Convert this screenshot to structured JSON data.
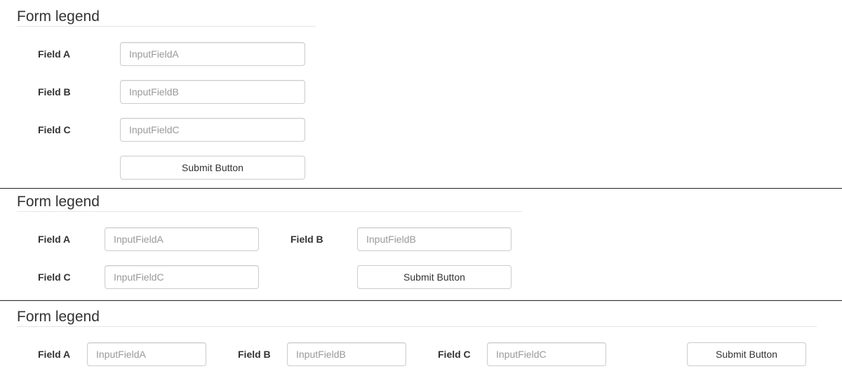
{
  "forms": [
    {
      "legend": "Form legend",
      "fields": [
        {
          "label": "Field A",
          "placeholder": "InputFieldA"
        },
        {
          "label": "Field B",
          "placeholder": "InputFieldB"
        },
        {
          "label": "Field C",
          "placeholder": "InputFieldC"
        }
      ],
      "submit_label": "Submit Button"
    },
    {
      "legend": "Form legend",
      "fields": [
        {
          "label": "Field A",
          "placeholder": "InputFieldA"
        },
        {
          "label": "Field B",
          "placeholder": "InputFieldB"
        },
        {
          "label": "Field C",
          "placeholder": "InputFieldC"
        }
      ],
      "submit_label": "Submit Button"
    },
    {
      "legend": "Form legend",
      "fields": [
        {
          "label": "Field A",
          "placeholder": "InputFieldA"
        },
        {
          "label": "Field B",
          "placeholder": "InputFieldB"
        },
        {
          "label": "Field C",
          "placeholder": "InputFieldC"
        }
      ],
      "submit_label": "Submit Button"
    }
  ]
}
